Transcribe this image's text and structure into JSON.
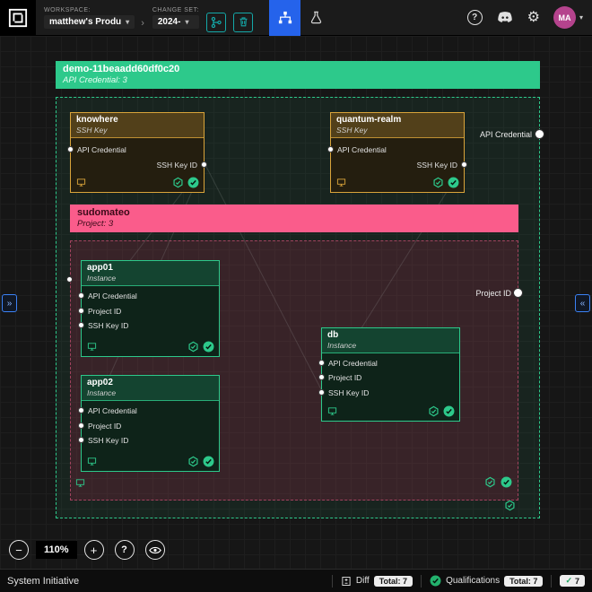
{
  "icons": {
    "caret_down": "▾",
    "breadcrumb_sep": "›",
    "minus": "−",
    "plus": "+",
    "help": "?",
    "gear": "⚙",
    "panel_expand_right": "»",
    "panel_expand_left": "«",
    "check": "✓"
  },
  "topbar": {
    "workspace_label": "WORKSPACE:",
    "workspace_value": "matthew's Produ",
    "changeset_label": "CHANGE SET:",
    "changeset_value": "2024-",
    "avatar_initials": "MA"
  },
  "frames": {
    "api": {
      "title": "demo-11beaadd60df0c20",
      "subtitle": "API Credential: 3",
      "socket_label": "API Credential"
    },
    "project": {
      "title": "sudomateo",
      "subtitle": "Project: 3",
      "socket_label": "Project ID"
    }
  },
  "components": [
    {
      "title": "knowhere",
      "type": "SSH Key",
      "input": "API Credential",
      "output": "SSH Key ID"
    },
    {
      "title": "quantum-realm",
      "type": "SSH Key",
      "input": "API Credential",
      "output": "SSH Key ID"
    },
    {
      "title": "app01",
      "type": "Instance",
      "inputs": [
        "API Credential",
        "Project ID",
        "SSH Key ID"
      ]
    },
    {
      "title": "app02",
      "type": "Instance",
      "inputs": [
        "API Credential",
        "Project ID",
        "SSH Key ID"
      ]
    },
    {
      "title": "db",
      "type": "Instance",
      "inputs": [
        "API Credential",
        "Project ID",
        "SSH Key ID"
      ]
    }
  ],
  "zoom": {
    "value": "110%"
  },
  "statusbar": {
    "app_name": "System Initiative",
    "diff_label": "Diff",
    "diff_total": "Total: 7",
    "qualifications_label": "Qualifications",
    "qualifications_total": "Total: 7",
    "qualifications_passed": "7"
  },
  "colors": {
    "green": "#2dc98b",
    "yellow": "#d9a43a",
    "pink": "#fa5c8b",
    "blue": "#2563eb",
    "teal": "#14a8a8"
  }
}
